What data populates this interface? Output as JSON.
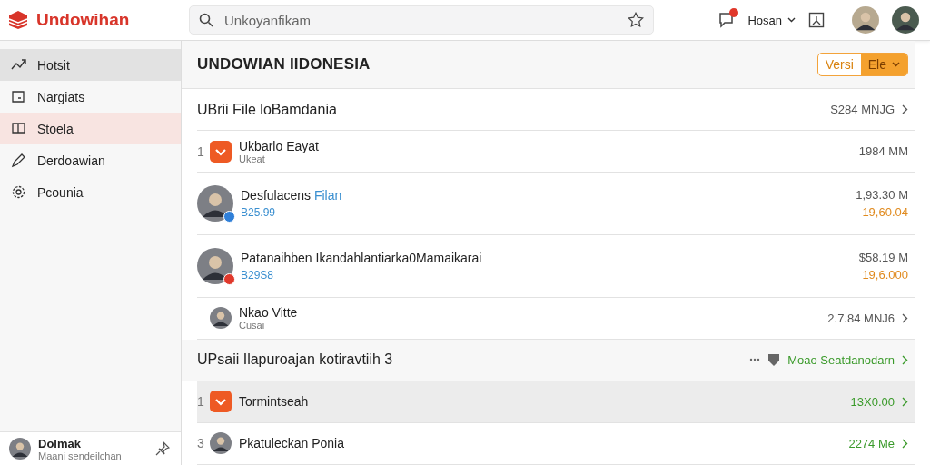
{
  "header": {
    "logo": "Undowihan",
    "search": {
      "placeholder": "Unkoyanfikam"
    },
    "user_menu": "Hosan",
    "notification": true
  },
  "sidebar": {
    "items": [
      {
        "label": "Hotsit",
        "selected": true,
        "highlighted": false
      },
      {
        "label": "Nargiats",
        "selected": false,
        "highlighted": false
      },
      {
        "label": "Stoela",
        "selected": false,
        "highlighted": true
      },
      {
        "label": "Derdoawian",
        "selected": false,
        "highlighted": false
      },
      {
        "label": "Pcounia",
        "selected": false,
        "highlighted": false
      }
    ],
    "user": {
      "name": "Dolmak",
      "subtitle": "Maani sendeilchan"
    }
  },
  "main": {
    "title": "UNDOWIAN IIDONESIA",
    "version_button": {
      "label": "Versi",
      "value": "Ele"
    },
    "sections": [
      {
        "title": "UBrii File loBamdania",
        "shaded": false,
        "value": "S284 MNJG",
        "color": "#555555",
        "more": false,
        "rows": [
          {
            "kind": "app",
            "index": "1",
            "title": "Ukbarlo Eayat",
            "subtitle": "Ukeat",
            "value": "1984 MM",
            "chevron": false,
            "shaded": false
          },
          {
            "kind": "person",
            "title": "Desfulacens",
            "link": "Filan",
            "subtitle": "B25.99",
            "value": "1,93.30 M",
            "secondary": "19,60.04",
            "chevron": false,
            "shaded": false,
            "color": "#2f7fd8"
          },
          {
            "kind": "person",
            "title": "Patanaihben Ikandahlantiarka0Mamaikarai",
            "subtitle": "B29S8",
            "value": "$58.19 M",
            "secondary": "19,6.000",
            "chevron": false,
            "shaded": false,
            "color": "#e0382b"
          },
          {
            "kind": "small-person",
            "title": "Nkao Vitte",
            "subtitle": "Cusai",
            "value": "2.7.84 MNJ6",
            "chevron": true,
            "shaded": false
          }
        ]
      },
      {
        "title": "UPsaii Ilapuroajan kotiravtiih 3",
        "shaded": true,
        "value": "Moao Seatdanodarn",
        "color": "#3a9a2a",
        "more": true,
        "rows": [
          {
            "kind": "app",
            "index": "1",
            "title": "Tormintseah",
            "value": "13X0.00",
            "chevron": true,
            "shaded": true
          },
          {
            "kind": "small-person",
            "index": "3",
            "title": "Pkatuleckan Ponia",
            "value": "2274 Me",
            "chevron": true,
            "shaded": false
          }
        ]
      }
    ]
  }
}
